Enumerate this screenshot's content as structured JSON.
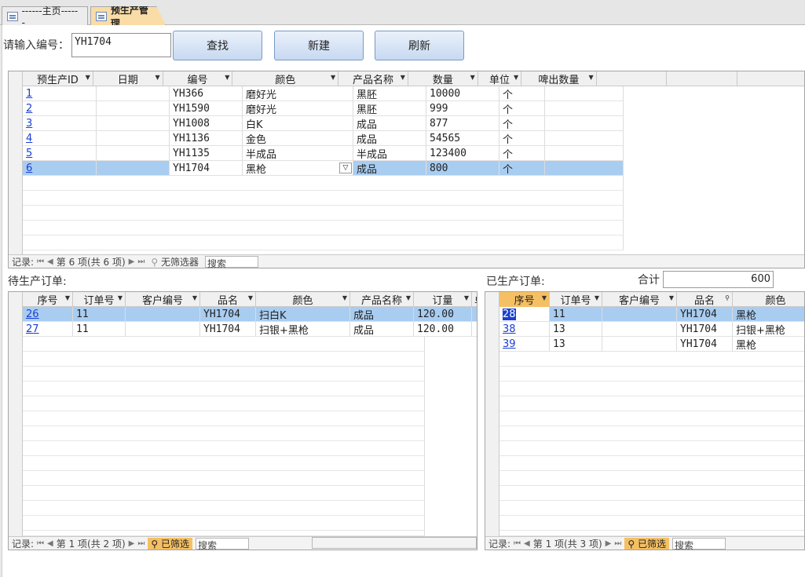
{
  "tabs": [
    {
      "label": "------主页------"
    },
    {
      "label": "预生产管理"
    }
  ],
  "search": {
    "label": "请输入编号：",
    "value": "YH1704"
  },
  "buttons": {
    "find": "查找",
    "new": "新建",
    "refresh": "刷新"
  },
  "main_grid": {
    "columns": [
      "预生产ID",
      "日期",
      "编号",
      "颜色",
      "产品名称",
      "数量",
      "单位",
      "啤出数量"
    ],
    "rows": [
      {
        "id": "1",
        "date": "",
        "code": "YH366",
        "color": "磨好光",
        "product": "黑胚",
        "qty": "10000",
        "unit": "个",
        "out": ""
      },
      {
        "id": "2",
        "date": "",
        "code": "YH1590",
        "color": "磨好光",
        "product": "黑胚",
        "qty": "999",
        "unit": "个",
        "out": ""
      },
      {
        "id": "3",
        "date": "",
        "code": "YH1008",
        "color": "白K",
        "product": "成品",
        "qty": "877",
        "unit": "个",
        "out": ""
      },
      {
        "id": "4",
        "date": "",
        "code": "YH1136",
        "color": "金色",
        "product": "成品",
        "qty": "54565",
        "unit": "个",
        "out": ""
      },
      {
        "id": "5",
        "date": "",
        "code": "YH1135",
        "color": "半成品",
        "product": "半成品",
        "qty": "123400",
        "unit": "个",
        "out": ""
      },
      {
        "id": "6",
        "date": "",
        "code": "YH1704",
        "color": "黑枪",
        "product": "成品",
        "qty": "800",
        "unit": "个",
        "out": ""
      }
    ],
    "nav": {
      "label": "记录:",
      "position": "第 6 项(共 6 项)",
      "filter": "无筛选器",
      "search": "搜索"
    }
  },
  "pending": {
    "title": "待生产订单:",
    "columns": [
      "序号",
      "订单号",
      "客户编号",
      "品名",
      "颜色",
      "产品名称",
      "订量",
      "单"
    ],
    "rows": [
      {
        "seq": "26",
        "order": "11",
        "cust": "",
        "name": "YH1704",
        "color": "扫白K",
        "product": "成品",
        "qty": "120.00"
      },
      {
        "seq": "27",
        "order": "11",
        "cust": "",
        "name": "YH1704",
        "color": "扫银+黑枪",
        "product": "成品",
        "qty": "120.00"
      }
    ],
    "nav": {
      "label": "记录:",
      "position": "第 1 项(共 2 项)",
      "filter": "已筛选",
      "search": "搜索"
    }
  },
  "produced": {
    "title": "已生产订单:",
    "total_label": "合计",
    "total_value": "600",
    "columns": [
      "序号",
      "订单号",
      "客户编号",
      "品名",
      "颜色"
    ],
    "rows": [
      {
        "seq": "28",
        "order": "11",
        "cust": "",
        "name": "YH1704",
        "color": "黑枪"
      },
      {
        "seq": "38",
        "order": "13",
        "cust": "",
        "name": "YH1704",
        "color": "扫银+黑枪"
      },
      {
        "seq": "39",
        "order": "13",
        "cust": "",
        "name": "YH1704",
        "color": "黑枪"
      }
    ],
    "nav": {
      "label": "记录:",
      "position": "第 1 项(共 3 项)",
      "filter": "已筛选",
      "search": "搜索"
    }
  }
}
